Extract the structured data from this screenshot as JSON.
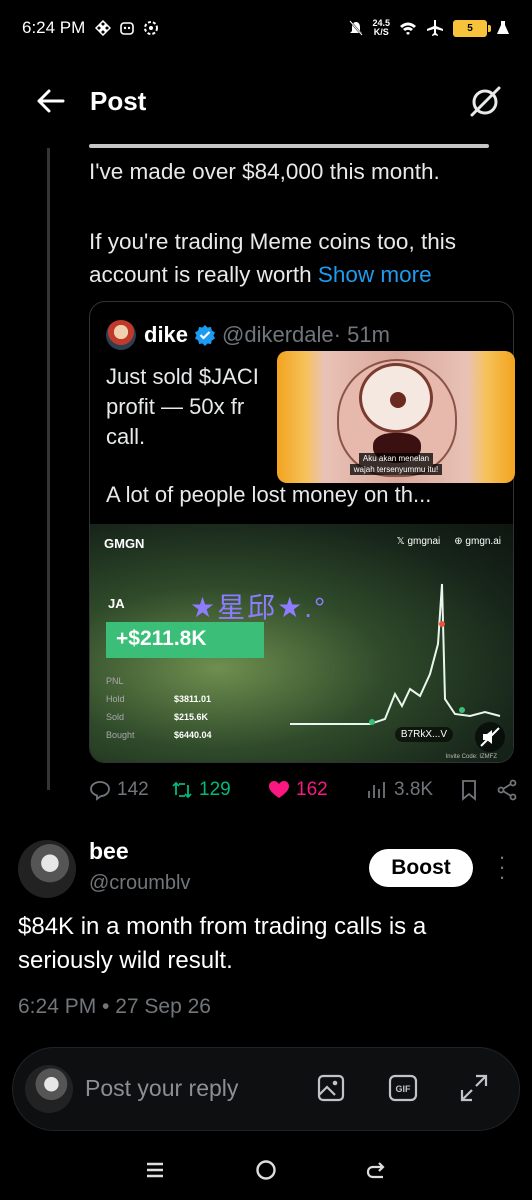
{
  "status": {
    "time": "6:24 PM",
    "net_speed_value": "24.5",
    "net_speed_unit": "K/S",
    "battery": "5"
  },
  "header": {
    "title": "Post"
  },
  "post": {
    "line1": "I've made over $84,000 this month.",
    "line2a": "If you're trading Meme coins too, this",
    "line2b": "account is really worth",
    "show_more": "Show more"
  },
  "quote": {
    "name": "dike",
    "handle": "@dikerdale",
    "time": "· 51m",
    "text1": "Just sold $JACI",
    "text2": "profit — 50x fr",
    "text3": "call.",
    "text4": "A lot of people lost money on th..."
  },
  "pip": {
    "sub1": "Aku akan menelan",
    "sub2": "wajah tersenyummu itu!"
  },
  "gmgn": {
    "logo": "GMGN",
    "link1": "gmgnai",
    "link2": "gmgn.ai",
    "ja": "JA",
    "deco": "★星邱★.°",
    "pnl": "+$211.8K",
    "stats": [
      {
        "k": "PNL",
        "v": ""
      },
      {
        "k": "Hold",
        "v": "$3811.01"
      },
      {
        "k": "Sold",
        "v": "$215.6K"
      },
      {
        "k": "Bought",
        "v": "$6440.04"
      }
    ],
    "token": "B7RkX...V",
    "invite": "Invite Code: IZMFZ"
  },
  "actions": {
    "replies": "142",
    "reposts": "129",
    "likes": "162",
    "views": "3.8K"
  },
  "reply": {
    "name": "bee",
    "handle": "@croumblv",
    "boost": "Boost",
    "text": "$84K in a month from trading calls is a seriously wild result.",
    "time": "6:24 PM • 27 Sep 26"
  },
  "composer": {
    "placeholder": "Post your reply",
    "gif": "GIF"
  },
  "colors": {
    "accent": "#1d9bf0",
    "like": "#f91880",
    "repost": "#00ba7c",
    "pnl": "#3bbf78"
  }
}
